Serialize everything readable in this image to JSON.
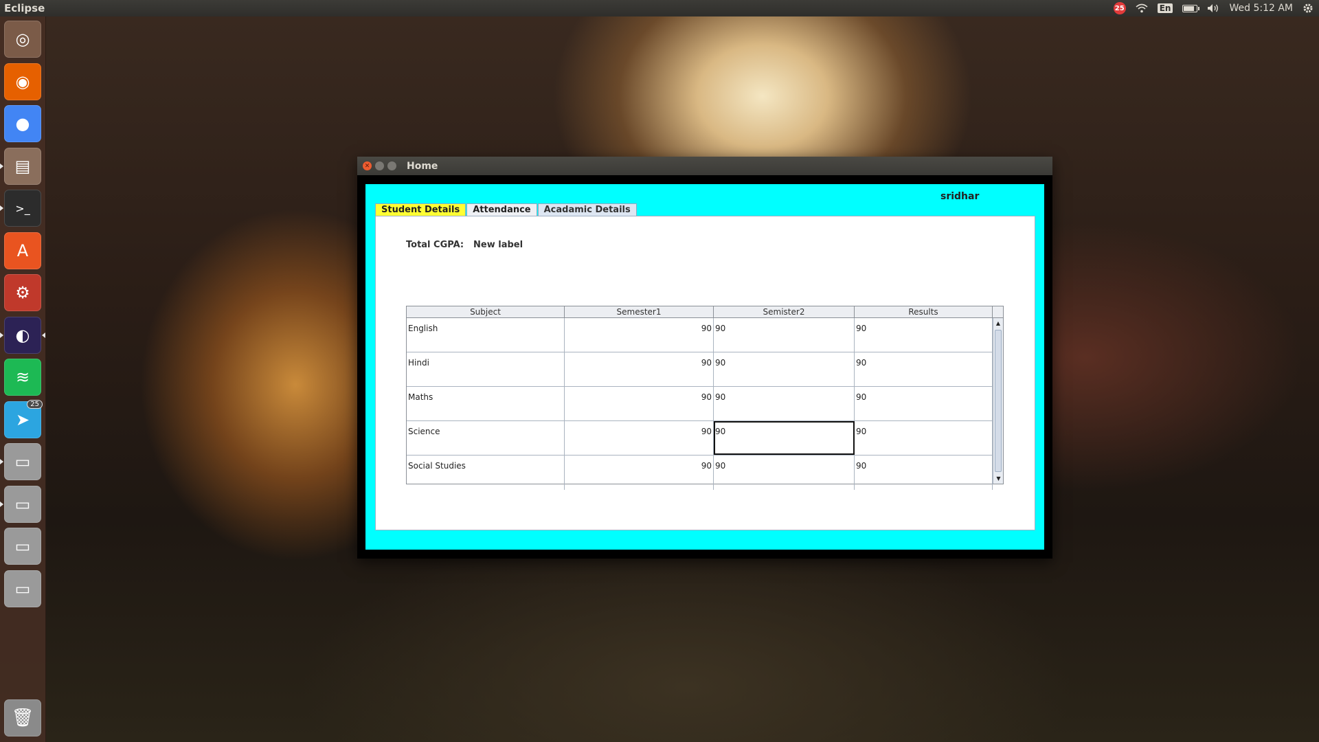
{
  "top_panel": {
    "app_title": "Eclipse",
    "notification_count": "25",
    "language": "En",
    "clock": "Wed 5:12 AM",
    "battery_fraction": 0.8
  },
  "launcher": {
    "items": [
      {
        "name": "ubuntu-dash-icon",
        "color": "#7b5b48"
      },
      {
        "name": "firefox-icon",
        "color": "#e66000"
      },
      {
        "name": "chrome-icon",
        "color": "#4285f4"
      },
      {
        "name": "files-icon",
        "color": "#8a6e5c"
      },
      {
        "name": "terminal-icon",
        "color": "#2c2c2c"
      },
      {
        "name": "software-center-icon",
        "color": "#e95420"
      },
      {
        "name": "settings-icon",
        "color": "#c0392b"
      },
      {
        "name": "eclipse-icon",
        "color": "#2c2255"
      },
      {
        "name": "spotify-icon",
        "color": "#1db954"
      },
      {
        "name": "telegram-icon",
        "color": "#2ca5e0"
      },
      {
        "name": "drive-icon",
        "color": "#9a9a9a"
      },
      {
        "name": "drive-icon",
        "color": "#9a9a9a"
      },
      {
        "name": "drive-icon",
        "color": "#9a9a9a"
      },
      {
        "name": "drive-icon",
        "color": "#9a9a9a"
      }
    ],
    "telegram_badge": "25",
    "trash_icon": "trash-icon"
  },
  "window": {
    "title": "Home",
    "user": "sridhar",
    "tabs": [
      {
        "label": "Student Details",
        "state": "active"
      },
      {
        "label": "Attendance",
        "state": "normal"
      },
      {
        "label": "Acadamic Details",
        "state": "selected"
      }
    ],
    "cgpa_label": "Total CGPA:",
    "cgpa_value": "New label",
    "table": {
      "columns": [
        "Subject",
        "Semester1",
        "Semister2",
        "Results"
      ],
      "rows": [
        [
          "English",
          "90",
          "90",
          "90"
        ],
        [
          "Hindi",
          "90",
          "90",
          "90"
        ],
        [
          "Maths",
          "90",
          "90",
          "90"
        ],
        [
          "Science",
          "90",
          "90",
          "90"
        ],
        [
          "Social Studies",
          "90",
          "90",
          "90"
        ]
      ]
    }
  },
  "colors": {
    "content_bg": "#00ffff",
    "active_tab": "#ffff33"
  }
}
